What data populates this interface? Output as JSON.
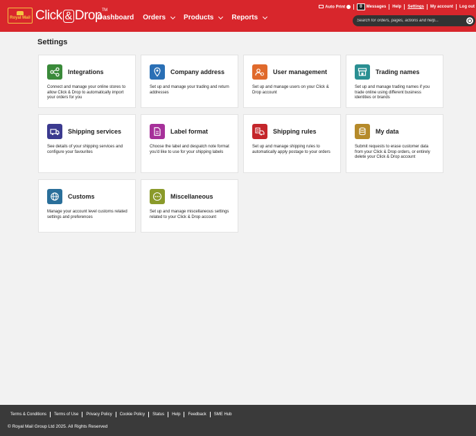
{
  "brand": {
    "logo_text": "Royal Mail",
    "name_left": "Click",
    "name_amp": "&",
    "name_right": "Drop",
    "tm": "TM"
  },
  "nav": {
    "dashboard": "Dashboard",
    "orders": "Orders",
    "products": "Products",
    "reports": "Reports"
  },
  "toplinks": {
    "auto_print": "Auto Print",
    "message_count": "0",
    "messages": "Messages",
    "help": "Help",
    "settings": "Settings",
    "my_account": "My account",
    "log_out": "Log out"
  },
  "search": {
    "placeholder": "Search for orders, pages, actions and help..."
  },
  "page": {
    "title": "Settings"
  },
  "cards": [
    {
      "title": "Integrations",
      "desc": "Connect and manage your online stores to allow Click & Drop to automatically import your orders for you",
      "color": "#3a8a3a",
      "icon": "integrations-icon"
    },
    {
      "title": "Company address",
      "desc": "Set up and manage your trading and return addresses",
      "color": "#2a6fb5",
      "icon": "location-pin-icon"
    },
    {
      "title": "User management",
      "desc": "Set up and manage users on your Click & Drop account",
      "color": "#e06a2c",
      "icon": "users-icon"
    },
    {
      "title": "Trading names",
      "desc": "Set up and manage trading names if you trade online using different business identities or brands",
      "color": "#2a8f92",
      "icon": "shop-icon"
    },
    {
      "title": "Shipping services",
      "desc": "See details of your shipping services and configure your favourites",
      "color": "#3b3a8f",
      "icon": "truck-icon"
    },
    {
      "title": "Label format",
      "desc": "Choose the label and despatch note format you'd like to use for your shipping labels",
      "color": "#a6319a",
      "icon": "document-icon"
    },
    {
      "title": "Shipping rules",
      "desc": "Set up and manage shipping rules to automatically apply postage to your orders",
      "color": "#c4262b",
      "icon": "rules-truck-icon"
    },
    {
      "title": "My data",
      "desc": "Submit requests to erase customer data from your Click & Drop orders, or entirely delete your Click & Drop account",
      "color": "#b58a2a",
      "icon": "database-icon"
    },
    {
      "title": "Customs",
      "desc": "Manage your account level customs related settings and preferences",
      "color": "#2a6f9a",
      "icon": "globe-icon"
    },
    {
      "title": "Miscellaneous",
      "desc": "Set up and manage miscellaneous settings related to your Click & Drop account",
      "color": "#8a9a2a",
      "icon": "more-icon"
    }
  ],
  "footer": {
    "links": [
      "Terms & Conditions",
      "Terms of Use",
      "Privacy Policy",
      "Cookie Policy",
      "Status",
      "Help",
      "Feedback",
      "SME Hub"
    ],
    "copyright": "© Royal Mail Group Ltd 2025. All Rights Reserved"
  }
}
